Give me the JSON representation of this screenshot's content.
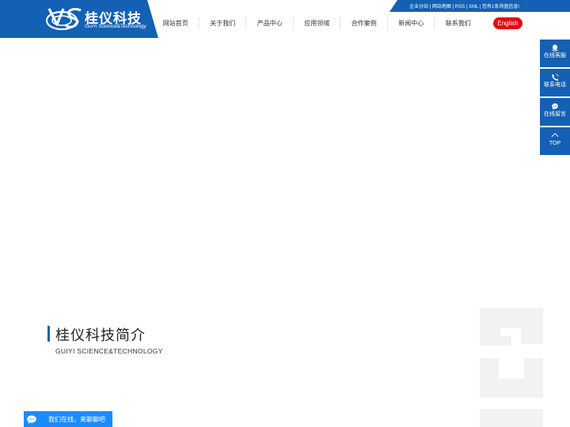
{
  "brand": {
    "name_cn": "桂仪科技",
    "name_en": "GuiYi Science&Technology"
  },
  "top_links": "企业分站 | 网站地图 | RSS | XML | 您有1条询盘信息!",
  "nav": [
    {
      "label": "网站首页"
    },
    {
      "label": "关于我们"
    },
    {
      "label": "产品中心"
    },
    {
      "label": "应用领域"
    },
    {
      "label": "合作案例"
    },
    {
      "label": "新闻中心"
    },
    {
      "label": "联系我们"
    }
  ],
  "language_button": "English",
  "sidebar": [
    {
      "label": "在线客服",
      "icon": "customer-service-icon"
    },
    {
      "label": "联系电话",
      "icon": "phone-icon"
    },
    {
      "label": "在线留言",
      "icon": "message-icon"
    },
    {
      "label": "TOP",
      "icon": "arrow-up-icon"
    }
  ],
  "about": {
    "title": "桂仪科技简介",
    "subtitle": "GUIYI SCIENCE&TECHNOLOGY"
  },
  "chat": {
    "label": "我们在线，来聊聊吧",
    "icon": "chat-bubble-icon"
  },
  "colors": {
    "brand_blue": "#1460b4",
    "accent_red": "#e60012",
    "chat_blue": "#1a8cff",
    "watermark": "#f2f2f2"
  }
}
